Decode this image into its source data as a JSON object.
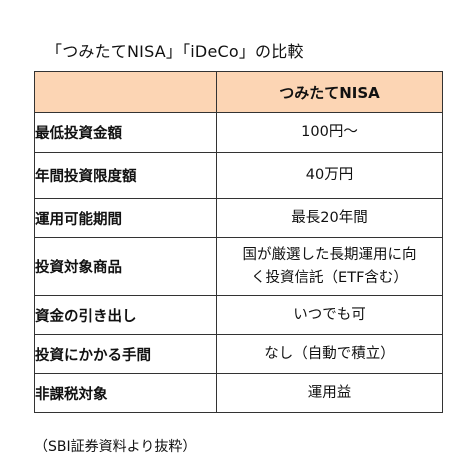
{
  "title": "「つみたてNISA」「iDeCo」の比較",
  "table": {
    "header": [
      "",
      "つみたてNISA"
    ],
    "rows": [
      {
        "label": "最低投資金額",
        "value": "100円～"
      },
      {
        "label": "年間投資限度額",
        "value": "40万円"
      },
      {
        "label": "運用可能期間",
        "value": "最長20年間"
      },
      {
        "label": "投資対象商品",
        "value_lines": [
          "国が厳選した長期運用に向",
          "く投資信託（ETF含む）"
        ]
      },
      {
        "label": "資金の引き出し",
        "value": "いつでも可"
      },
      {
        "label": "投資にかかる手間",
        "value": "なし（自動で積立）"
      },
      {
        "label": "非課税対象",
        "value": "運用益"
      }
    ]
  },
  "source": "（SBI証券資料より抜粋）",
  "colors": {
    "header_bg": "#fcd5b4",
    "border": "#333333",
    "text": "#111111"
  }
}
